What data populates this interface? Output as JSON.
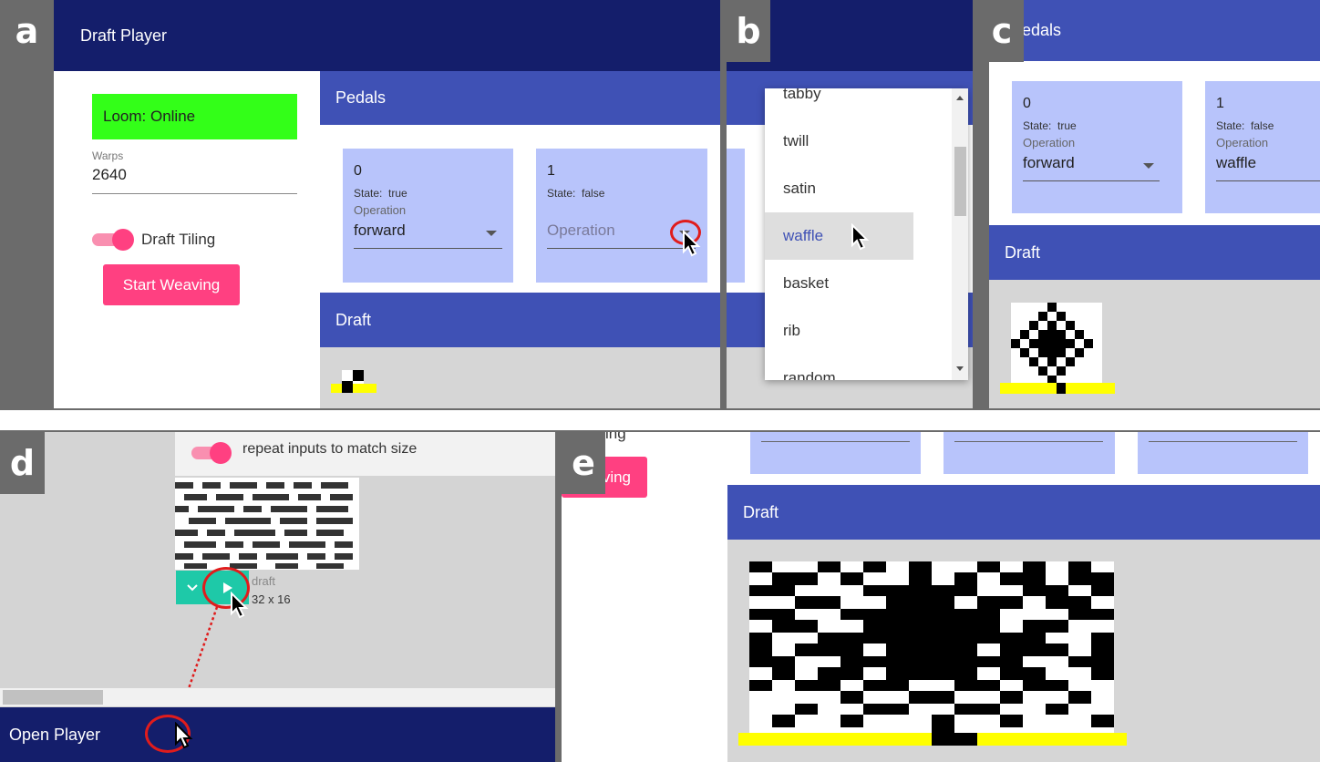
{
  "panel_labels": {
    "a": "a",
    "b": "b",
    "c": "c",
    "d": "d",
    "e": "e"
  },
  "a": {
    "header_title": "Draft Player",
    "loom_status": "Loom: Online",
    "warps_label": "Warps",
    "warps_value": "2640",
    "draft_tiling_label": "Draft Tiling",
    "start_button": "Start Weaving",
    "pedals_header": "Pedals",
    "pedal0": {
      "number": "0",
      "state_label": "State:",
      "state_value": "true",
      "operation_label": "Operation",
      "operation_value": "forward"
    },
    "pedal1": {
      "number": "1",
      "state_label": "State:",
      "state_value": "false",
      "operation_placeholder": "Operation"
    },
    "draft_header": "Draft"
  },
  "b": {
    "options": [
      "tabby",
      "twill",
      "satin",
      "waffle",
      "basket",
      "rib",
      "random"
    ],
    "selected": "waffle"
  },
  "c": {
    "pedals_header": "edals",
    "pedal0": {
      "number": "0",
      "state_label": "State:",
      "state_value": "true",
      "operation_label": "Operation",
      "operation_value": "forward"
    },
    "pedal1": {
      "number": "1",
      "state_label": "State:",
      "state_value": "false",
      "operation_label": "Operation",
      "operation_value": "waffle"
    },
    "draft_header": "Draft"
  },
  "d": {
    "repeat_label": "repeat inputs to match size",
    "draft_name": "draft",
    "draft_size": "32 x 16",
    "open_player": "Open Player"
  },
  "e": {
    "partial_label": "ing",
    "partial_button": "ving",
    "draft_header": "Draft"
  },
  "colors": {
    "navy": "#141e6b",
    "indigo": "#3f51b5",
    "card": "#b8c4fb",
    "pink": "#ff4081",
    "green": "#33ff18",
    "teal": "#1ec9a8",
    "yellow": "#ffff00",
    "red": "#e01c1c"
  }
}
